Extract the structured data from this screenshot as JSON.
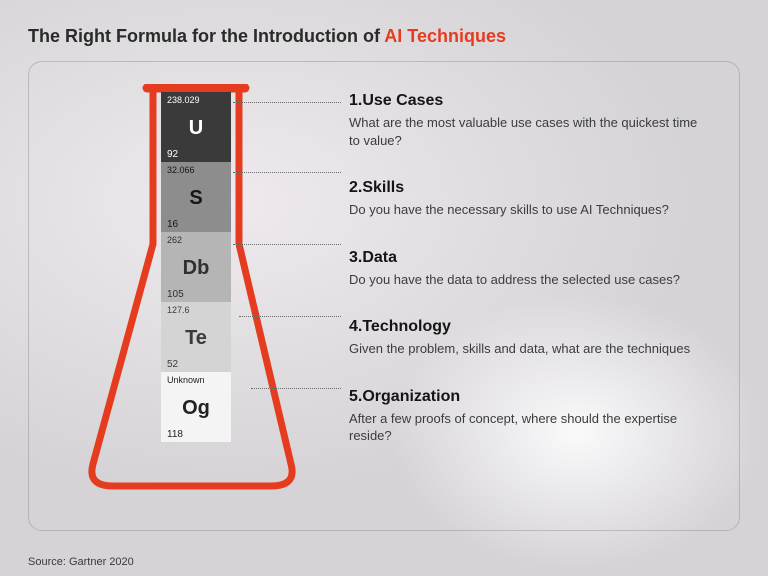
{
  "title_prefix": "The Right Formula for the Introduction of ",
  "title_highlight": "AI Techniques",
  "elements": [
    {
      "mass": "238.029",
      "symbol": "U",
      "atomic": "92"
    },
    {
      "mass": "32.066",
      "symbol": "S",
      "atomic": "16"
    },
    {
      "mass": "262",
      "symbol": "Db",
      "atomic": "105"
    },
    {
      "mass": "127.6",
      "symbol": "Te",
      "atomic": "52"
    },
    {
      "mass": "Unknown",
      "symbol": "Og",
      "atomic": "118"
    }
  ],
  "items": [
    {
      "heading": "1.Use Cases",
      "body": "What are the most valuable use cases with the quickest time to value?"
    },
    {
      "heading": "2.Skills",
      "body": "Do you have the necessary skills to use AI Techniques?"
    },
    {
      "heading": "3.Data",
      "body": "Do you have the data to address the selected use cases?"
    },
    {
      "heading": "4.Technology",
      "body": "Given the problem, skills and data, what are the techniques"
    },
    {
      "heading": "5.Organization",
      "body": "After a few proofs of concept, where should the expertise reside?"
    }
  ],
  "source": "Source: Gartner 2020"
}
